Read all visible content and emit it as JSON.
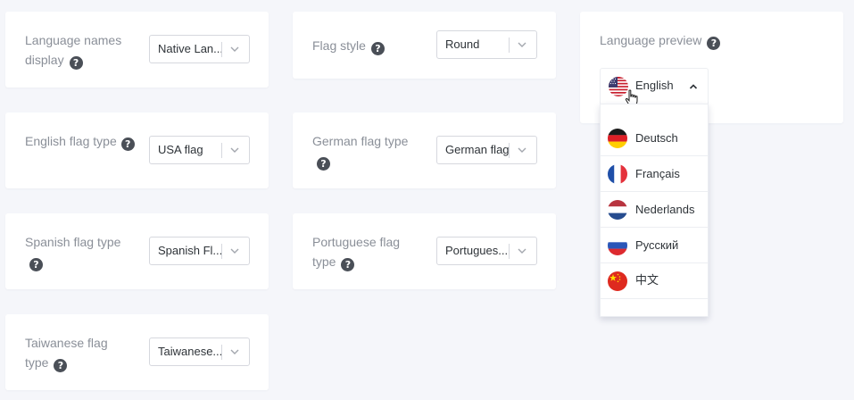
{
  "settings": {
    "language_names_display": {
      "label": "Language names display",
      "value": "Native Lan..."
    },
    "flag_style": {
      "label": "Flag style",
      "value": "Round"
    },
    "english_flag_type": {
      "label": "English flag type",
      "value": "USA flag"
    },
    "german_flag_type": {
      "label": "German flag type",
      "value": "German flag"
    },
    "spanish_flag_type": {
      "label": "Spanish flag type",
      "value": "Spanish Fl..."
    },
    "portuguese_flag_type": {
      "label": "Portuguese flag type",
      "value": "Portugues..."
    },
    "taiwanese_flag_type": {
      "label": "Taiwanese flag type",
      "value": "Taiwanese..."
    }
  },
  "help_glyph": "?",
  "preview": {
    "label": "Language preview",
    "current": {
      "name": "English",
      "flag": "usa-flag-icon"
    },
    "options": [
      {
        "name": "Deutsch",
        "flag": "germany-flag-icon"
      },
      {
        "name": "Français",
        "flag": "france-flag-icon"
      },
      {
        "name": "Nederlands",
        "flag": "netherlands-flag-icon"
      },
      {
        "name": "Русский",
        "flag": "russia-flag-icon"
      },
      {
        "name": "中文",
        "flag": "china-flag-icon"
      }
    ]
  },
  "colors": {
    "page_background": "#f5f6fa",
    "card_background": "#ffffff",
    "label_text": "#8a8f98",
    "value_text": "#2e3338",
    "help_icon": "#4a4f57",
    "border": "#d6d8de"
  }
}
